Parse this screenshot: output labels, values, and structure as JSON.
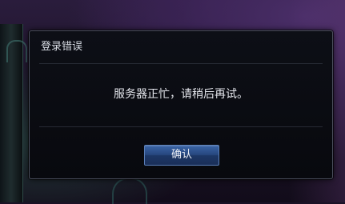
{
  "dialog": {
    "title": "登录错误",
    "message": "服务器正忙，请稍后再试。",
    "confirm_label": "确认"
  },
  "colors": {
    "dialog_background": "#0b0c12",
    "dialog_border": "#4a4e5c",
    "button_blue": "#27477e",
    "text": "#e4e6ec"
  }
}
